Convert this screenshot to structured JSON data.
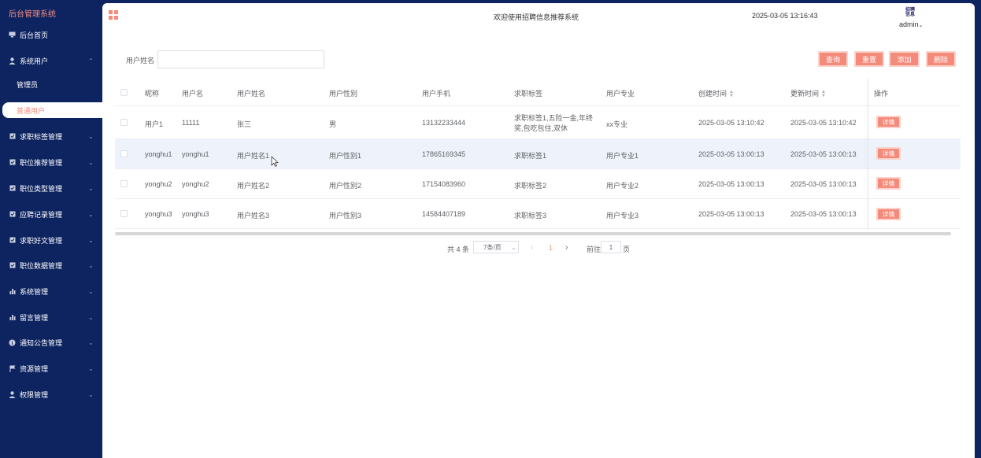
{
  "sidebar": {
    "brand": "后台管理系统",
    "items": [
      {
        "label": "后台首页",
        "icon": "monitor-icon"
      },
      {
        "label": "系统用户",
        "icon": "user-icon",
        "expanded": true
      },
      {
        "label": "求职标签管理",
        "icon": "checkbox-icon"
      },
      {
        "label": "职位推荐管理",
        "icon": "checkbox-icon"
      },
      {
        "label": "职位类型管理",
        "icon": "checkbox-icon"
      },
      {
        "label": "应聘记录管理",
        "icon": "checkbox-icon"
      },
      {
        "label": "求职好文管理",
        "icon": "checkbox-icon"
      },
      {
        "label": "职位数据管理",
        "icon": "checkbox-icon"
      },
      {
        "label": "系统管理",
        "icon": "bar-chart-icon"
      },
      {
        "label": "留言管理",
        "icon": "bar-chart-icon"
      },
      {
        "label": "通知公告管理",
        "icon": "info-icon"
      },
      {
        "label": "资源管理",
        "icon": "flag-icon"
      },
      {
        "label": "权限管理",
        "icon": "user-icon"
      }
    ],
    "subitems": [
      {
        "label": "管理员"
      },
      {
        "label": "普通用户",
        "active": true
      }
    ]
  },
  "header": {
    "title": "欢迎使用招聘信息推荐系统",
    "time": "2025-03-05 13:16:43",
    "avatar_text": "招聘\n信息",
    "user": "admin"
  },
  "search": {
    "label": "用户姓名",
    "value": ""
  },
  "buttons": {
    "query": "查询",
    "reset": "重置",
    "add": "添加",
    "delete": "删除"
  },
  "table": {
    "columns": [
      "昵称",
      "用户名",
      "用户姓名",
      "用户性别",
      "用户手机",
      "求职标签",
      "用户专业",
      "创建时间",
      "更新时间",
      "操作"
    ],
    "rows": [
      {
        "nickname": "用户1",
        "username": "11111",
        "realname": "张三",
        "gender": "男",
        "phone": "13132233444",
        "tags": "求职标签1,五险一金,年终奖,包吃包住,双休",
        "major": "xx专业",
        "created": "2025-03-05 13:10:42",
        "updated": "2025-03-05 13:10:42"
      },
      {
        "nickname": "yonghu1",
        "username": "yonghu1",
        "realname": "用户姓名1",
        "gender": "用户性别1",
        "phone": "17865169345",
        "tags": "求职标签1",
        "major": "用户专业1",
        "created": "2025-03-05 13:00:13",
        "updated": "2025-03-05 13:00:13"
      },
      {
        "nickname": "yonghu2",
        "username": "yonghu2",
        "realname": "用户姓名2",
        "gender": "用户性别2",
        "phone": "17154083960",
        "tags": "求职标签2",
        "major": "用户专业2",
        "created": "2025-03-05 13:00:13",
        "updated": "2025-03-05 13:00:13"
      },
      {
        "nickname": "yonghu3",
        "username": "yonghu3",
        "realname": "用户姓名3",
        "gender": "用户性别3",
        "phone": "14584407189",
        "tags": "求职标签3",
        "major": "用户专业3",
        "created": "2025-03-05 13:00:13",
        "updated": "2025-03-05 13:00:13"
      }
    ],
    "detail_label": "详情"
  },
  "pagination": {
    "total": "共 4 条",
    "page_size": "7条/页",
    "current": "1",
    "goto_label": "前往",
    "goto_value": "1",
    "page_suffix": "页"
  },
  "colors": {
    "sidebar_bg": "#0e2460",
    "accent": "#f48a7a"
  }
}
